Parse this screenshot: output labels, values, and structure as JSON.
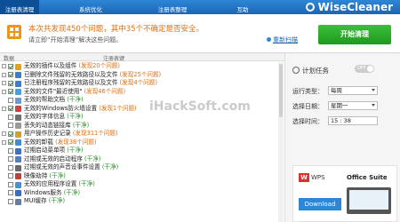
{
  "topbar": {
    "tabs": [
      {
        "label": "注册表清理",
        "active": true
      },
      {
        "label": "系统优化",
        "active": false
      },
      {
        "label": "注册表整理",
        "active": false
      },
      {
        "label": "互助",
        "active": false
      }
    ],
    "brand": "WiseCleaner"
  },
  "alert": {
    "title": "本次共发现450个问题，其中35个不确定是否安全。",
    "subtitle": "请立即“开始清理”解决这些问题。",
    "help": "重新扫描",
    "start_button": "开始清理"
  },
  "list_header": {
    "col1": "数据",
    "col2": "注册表键"
  },
  "rows": [
    {
      "label": "无效的插件以及组件",
      "count": "(发现20个问题)",
      "status": "found",
      "expand": true,
      "checked": true,
      "color": "#e0a020"
    },
    {
      "label": "已删除文件残留的无效路径以及文件",
      "count": "(发现25个问题)",
      "status": "found",
      "expand": true,
      "checked": true,
      "color": "#3a7fd0"
    },
    {
      "label": "已注册程序残留的无效路径以及文件",
      "count": "(发现4个问题)",
      "status": "found",
      "expand": true,
      "checked": true,
      "color": "#3a7fd0"
    },
    {
      "label": "无效的文件\"最近使用\"",
      "count": "(发现46个问题)",
      "status": "found",
      "expand": true,
      "checked": true,
      "color": "#4aa0e0"
    },
    {
      "label": "无效的帮助文档",
      "count": "(干净)",
      "status": "clean",
      "expand": false,
      "checked": false,
      "color": "#6a9ad0"
    },
    {
      "label": "无效的Windows防火墙设置",
      "count": "(发现1个问题)",
      "status": "found",
      "expand": true,
      "checked": true,
      "color": "#d04040"
    },
    {
      "label": "无效的字体信息",
      "count": "(干净)",
      "status": "clean",
      "expand": false,
      "checked": false,
      "color": "#707070"
    },
    {
      "label": "丢失的动态链接库",
      "count": "(干净)",
      "status": "clean",
      "expand": false,
      "checked": false,
      "color": "#9a9a9a"
    },
    {
      "label": "用户操作历史记录",
      "count": "(发现311个问题)",
      "status": "found",
      "expand": true,
      "checked": true,
      "color": "#d0a030"
    },
    {
      "label": "无效的卸载",
      "count": "(发现38个问题)",
      "status": "found",
      "expand": true,
      "checked": true,
      "color": "#3a90d0"
    },
    {
      "label": "过期启动菜单项",
      "count": "(干净)",
      "status": "clean",
      "expand": false,
      "checked": false,
      "color": "#4070c0"
    },
    {
      "label": "过期或无效的启动程序",
      "count": "(干净)",
      "status": "clean",
      "expand": false,
      "checked": false,
      "color": "#5080c0"
    },
    {
      "label": "过期或无效的声音设事件设置",
      "count": "(干净)",
      "status": "clean",
      "expand": false,
      "checked": false,
      "color": "#6a6a6a"
    },
    {
      "label": "映像劫持",
      "count": "(干净)",
      "status": "clean",
      "expand": false,
      "checked": false,
      "color": "#c04040"
    },
    {
      "label": "无效的应用程序设置",
      "count": "(干净)",
      "status": "clean",
      "expand": false,
      "checked": false,
      "color": "#4a90d0"
    },
    {
      "label": "Windows服务",
      "count": "(干净)",
      "status": "clean",
      "expand": false,
      "checked": false,
      "color": "#3070c0"
    },
    {
      "label": "MUI缓存",
      "count": "(干净)",
      "status": "clean",
      "expand": false,
      "checked": false,
      "color": "#6080a0"
    }
  ],
  "schedule": {
    "title": "计划任务",
    "toggle": "OFF",
    "run_type_label": "运行类型：",
    "run_type": "每周",
    "date_label": "选择日期：",
    "date": "星期一",
    "time_label": "选择时间：",
    "time": "15 : 38"
  },
  "ad": {
    "logo": "W",
    "brand": "WPS",
    "suite": "Office Suite",
    "download": "Download"
  },
  "watermark": "iHackSoft.com"
}
